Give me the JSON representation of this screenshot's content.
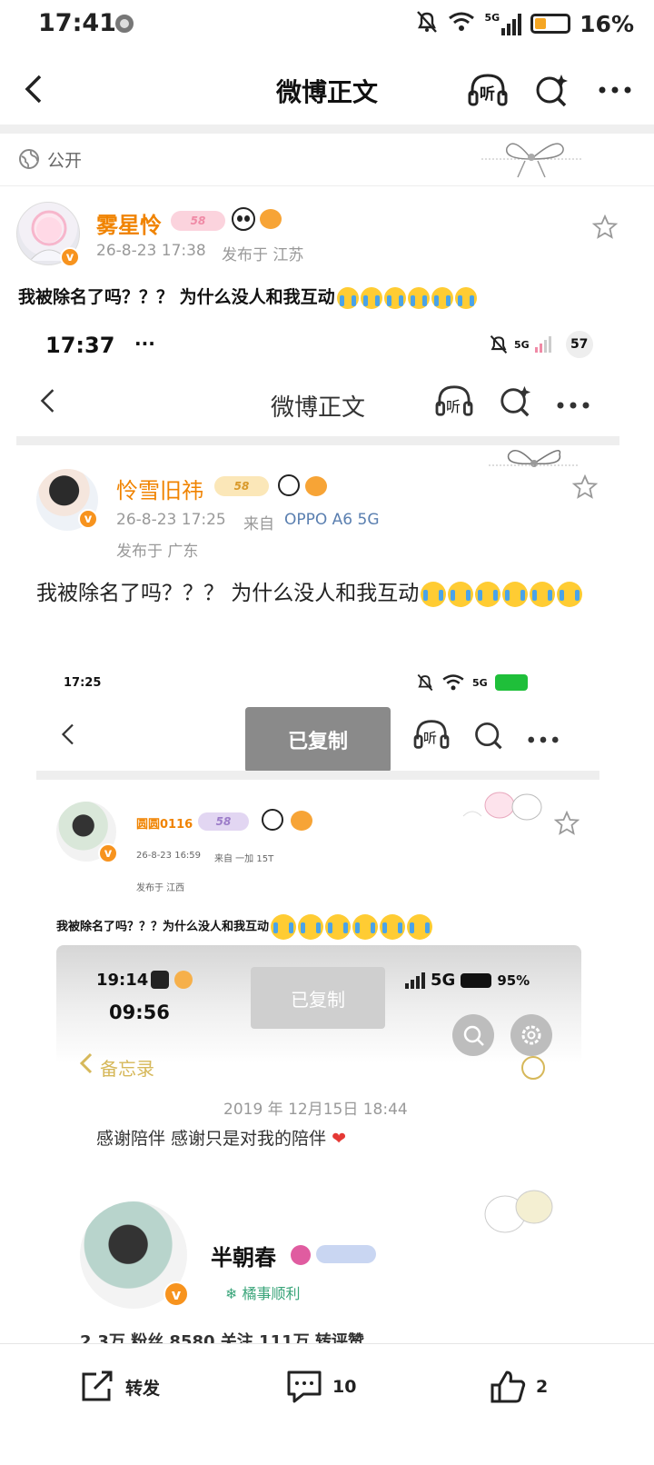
{
  "status_bar": {
    "time": "17:41",
    "battery": "16%",
    "network": "5G",
    "icons": [
      "mute-bell-icon",
      "wifi-icon",
      "signal-icon",
      "battery-icon"
    ]
  },
  "nav": {
    "title": "微博正文",
    "listen_label": "听",
    "icons": [
      "back-arrow-icon",
      "listen-icon",
      "search-sparkle-icon",
      "more-icon"
    ]
  },
  "visibility": {
    "label": "公开",
    "icon": "globe-icon"
  },
  "post": {
    "author": "雾星怜",
    "level": "58",
    "timestamp": "26-8-23 17:38",
    "location": "发布于 江苏",
    "text": "我被除名了吗？？？ 为什么没人和我互动",
    "emoji_count": 6
  },
  "nested1": {
    "time": "17:37",
    "dots": "···",
    "battery": "57",
    "network": "5G",
    "title": "微博正文",
    "listen_label": "听",
    "author": "怜雪旧祎",
    "level": "58",
    "timestamp": "26-8-23 17:25",
    "source_prefix": "来自",
    "source": "OPPO A6 5G",
    "location": "发布于 广东",
    "text": "我被除名了吗？？？ 为什么没人和我互动"
  },
  "nested2": {
    "time": "17:25",
    "network": "5G",
    "toast": "已复制",
    "listen_label": "听",
    "author": "圆圆0116",
    "level": "58",
    "timestamp": "26-8-23 16:59",
    "source": "来自 一加 15T",
    "location": "发布于 江西",
    "text": "我被除名了吗？？？为什么没人和我互动"
  },
  "nested3": {
    "time1": "19:14",
    "time2": "09:56",
    "network": "5G",
    "battery": "95%",
    "toast": "已复制",
    "back_label": "备忘录",
    "date": "2019 年 12月15日 18:44",
    "note": "感谢陪伴 感谢只是对我的陪伴",
    "author": "半朝春",
    "tag": "橘事顺利",
    "stats_partial": "2.3万 粉丝  8580 关注  111万 转评赞"
  },
  "bottom_bar": {
    "repost_label": "转发",
    "comment_count": "10",
    "like_count": "2"
  }
}
